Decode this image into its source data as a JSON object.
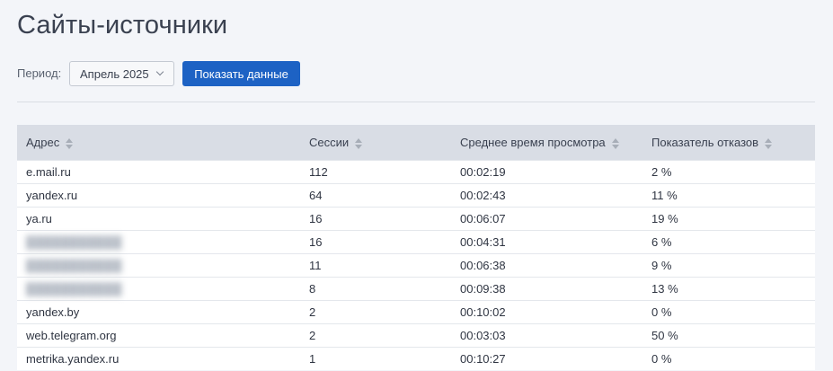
{
  "page": {
    "title": "Сайты-источники"
  },
  "filter": {
    "period_label": "Период:",
    "period_value": "Апрель 2025",
    "show_button_label": "Показать данные"
  },
  "table": {
    "columns": [
      "Адрес",
      "Сессии",
      "Среднее время просмотра",
      "Показатель отказов"
    ],
    "rows": [
      {
        "address": "e.mail.ru",
        "sessions": "112",
        "avg_time": "00:02:19",
        "bounce": "2 %",
        "blurred": false
      },
      {
        "address": "yandex.ru",
        "sessions": "64",
        "avg_time": "00:02:43",
        "bounce": "11 %",
        "blurred": false
      },
      {
        "address": "ya.ru",
        "sessions": "16",
        "avg_time": "00:06:07",
        "bounce": "19 %",
        "blurred": false
      },
      {
        "address": "",
        "sessions": "16",
        "avg_time": "00:04:31",
        "bounce": "6 %",
        "blurred": true
      },
      {
        "address": "",
        "sessions": "11",
        "avg_time": "00:06:38",
        "bounce": "9 %",
        "blurred": true
      },
      {
        "address": "",
        "sessions": "8",
        "avg_time": "00:09:38",
        "bounce": "13 %",
        "blurred": true
      },
      {
        "address": "yandex.by",
        "sessions": "2",
        "avg_time": "00:10:02",
        "bounce": "0 %",
        "blurred": false
      },
      {
        "address": "web.telegram.org",
        "sessions": "2",
        "avg_time": "00:03:03",
        "bounce": "50 %",
        "blurred": false
      },
      {
        "address": "metrika.yandex.ru",
        "sessions": "1",
        "avg_time": "00:10:27",
        "bounce": "0 %",
        "blurred": false
      }
    ]
  },
  "icons": {
    "sort": "sort-arrows-icon",
    "dropdown": "chevron-down-icon"
  },
  "colors": {
    "accent": "#1d62c4",
    "header_bg": "#d9dde5",
    "page_bg": "#f3f5f9"
  }
}
